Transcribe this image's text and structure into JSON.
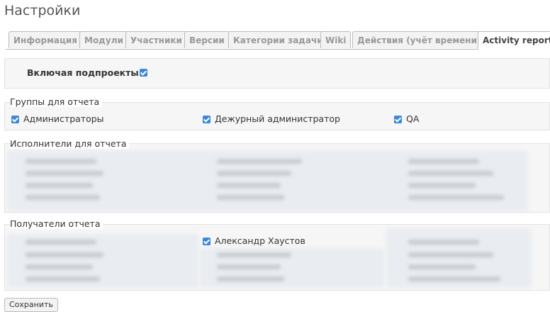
{
  "page": {
    "title": "Настройки"
  },
  "tabs": [
    {
      "label": "Информация",
      "active": false
    },
    {
      "label": "Модули",
      "active": false
    },
    {
      "label": "Участники",
      "active": false
    },
    {
      "label": "Версии",
      "active": false
    },
    {
      "label": "Категории задачи",
      "active": false
    },
    {
      "label": "Wiki",
      "active": false
    },
    {
      "label": "Действия (учёт времени)",
      "active": false
    },
    {
      "label": "Activity report",
      "active": true
    }
  ],
  "include_subprojects": {
    "label": "Включая подпроекты",
    "checked": true
  },
  "groups": {
    "legend": "Группы для отчета",
    "items": [
      {
        "label": "Администраторы",
        "checked": true
      },
      {
        "label": "Дежурный администратор",
        "checked": true
      },
      {
        "label": "QA",
        "checked": true
      }
    ]
  },
  "assignees": {
    "legend": "Исполнители для отчета"
  },
  "recipients": {
    "legend": "Получатели отчета",
    "visible_item": {
      "label": "Александр Хаустов",
      "checked": true
    }
  },
  "save_button": {
    "label": "Сохранить"
  },
  "colors": {
    "checkbox": "#3b88d8",
    "panel": "#f6f6f6",
    "tab_border": "#bbbbbb"
  }
}
